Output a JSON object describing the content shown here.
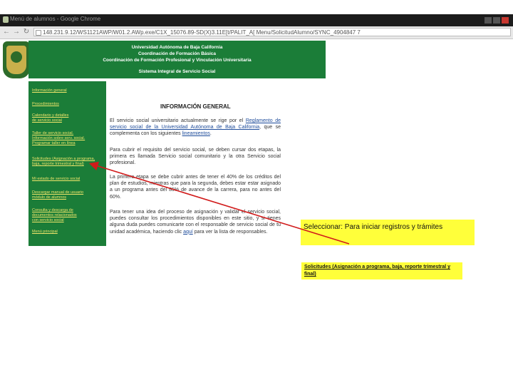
{
  "browser": {
    "tab_title": "Menú de alumnos - Google Chrome",
    "url": "148.231.9.12/WS1121AWP/W01.2.AWp.exe/C1X_15076.89-SD(X)3.11E[t/PALIT_A[ Menu/SolicitudAlumno/SYNC_4904847 7"
  },
  "header": {
    "line1": "Universidad Autónoma de Baja California",
    "line2": "Coordinación de Formación Básica",
    "line3": "Coordinación de Formación Profesional y Vinculación Universitaria",
    "line4": "Sistema Integral de Servicio Social"
  },
  "sidebar": {
    "items": [
      {
        "label": "Información general"
      },
      {
        "label": "Procedimientos"
      },
      {
        "label": "Calendario y detalles\nde servicio social"
      },
      {
        "label": "Taller de servicio social.\nInformación sobre serv. social.\nProgramar taller en línea"
      },
      {
        "label": "Solicitudes (Asignación a programa,\nbaja, reporte trimestral y final)"
      },
      {
        "label": "Mi estado de servicio social"
      },
      {
        "label": "Descargar manual de usuario\nmódulo de alumnos"
      },
      {
        "label": "Consulta y descarga de\ndocumentos relacionados\ncon servicio social"
      },
      {
        "label": "Menú principal"
      }
    ]
  },
  "content": {
    "title": "INFORMACIÓN GENERAL",
    "p1_a": "El servicio social universitario actualmente se rige por el ",
    "p1_link1": "Reglamento de servicio social de la Universidad Autónoma de Baja California",
    "p1_b": ", que se complementa con los siguientes ",
    "p1_link2": "lineamientos",
    "p1_c": ".",
    "p2": "Para cubrir el requisito del servicio social, se deben cursar dos etapas, la primera es llamada Servicio social comunitario y la otra Servicio social profesional.",
    "p3": "La primera etapa se debe cubrir antes de tener el 40% de los créditos del plan de estudios, mientras que para la segunda, debes estar estar asignado a un programa antes del 85% de avance de la carrera, para no antes del 60%.",
    "p4_a": "Para tener una idea del proceso de asignación y validar el servicio social, puedes consultar los procedimientos disponibles en este sitio, y si tienes alguna duda puedes comunicarte con el responsable de servicio social de tu unidad académica, haciendo clic ",
    "p4_link": "aquí",
    "p4_b": " para ver la lista de responsables."
  },
  "annotations": {
    "callout_text": "Seleccionar: Para iniciar registros y trámites",
    "link_callout": "Solicitudes (Asignación a programa, baja, reporte trimestral y final)"
  },
  "colors": {
    "uabc_green": "#1b7d38",
    "sidebar_link": "#f0e56a",
    "callout_yellow": "#ffff3a",
    "arrow_red": "#d11a1a"
  }
}
